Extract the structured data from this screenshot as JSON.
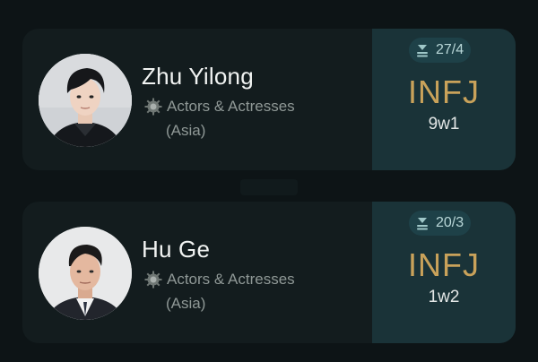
{
  "profiles": [
    {
      "name": "Zhu Yilong",
      "category": "Actors & Actresses",
      "region": "(Asia)",
      "votes": "27/4",
      "mbti": "INFJ",
      "enneagram": "9w1",
      "category_icon": "gear-badge-icon",
      "vote_icon": "vote-stack-icon"
    },
    {
      "name": "Hu Ge",
      "category": "Actors & Actresses",
      "region": "(Asia)",
      "votes": "20/3",
      "mbti": "INFJ",
      "enneagram": "1w2",
      "category_icon": "gear-badge-icon",
      "vote_icon": "vote-stack-icon"
    }
  ],
  "colors": {
    "background": "#0d1416",
    "card": "#131c1e",
    "type_panel": "#1a3338",
    "mbti_accent": "#c9a25a"
  }
}
